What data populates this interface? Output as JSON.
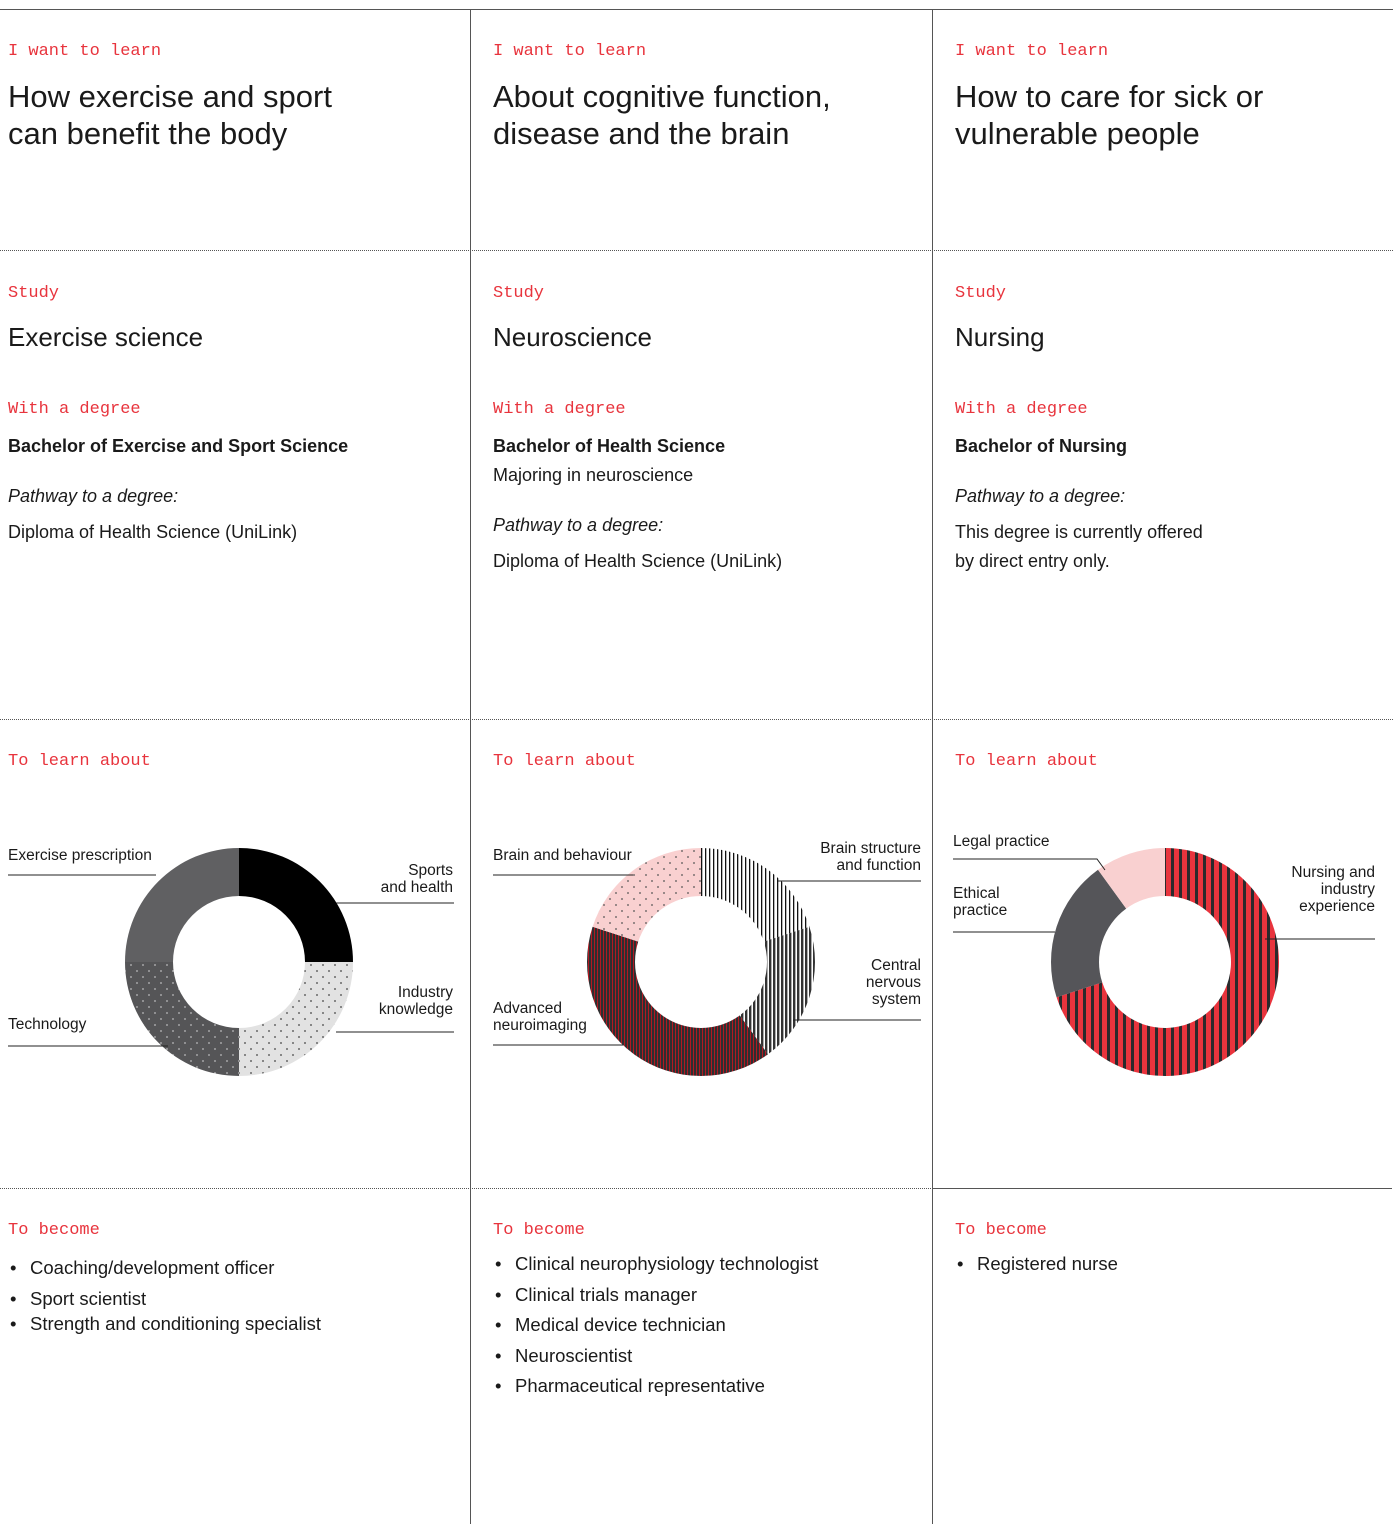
{
  "columns": [
    {
      "kicker": "I want to learn",
      "heading": [
        "How exercise and sport",
        "can benefit the body"
      ],
      "study_label": "Study",
      "study": "Exercise science",
      "degree_label": "With a degree",
      "degree": "Bachelor of Exercise and Sport Science",
      "major": "",
      "pathway_label": "Pathway to a degree:",
      "pathway": [
        "Diploma of Health Science (UniLink)"
      ],
      "learn_label": "To learn about",
      "become_label": "To become",
      "careers": [
        "Coaching/development officer",
        "Sport scientist",
        "Strength and conditioning specialist"
      ]
    },
    {
      "kicker": "I want to learn",
      "heading": [
        "About cognitive function,",
        "disease and the brain"
      ],
      "study_label": "Study",
      "study": "Neuroscience",
      "degree_label": "With a degree",
      "degree": "Bachelor of Health Science",
      "major": "Majoring in neuroscience",
      "pathway_label": "Pathway to a degree:",
      "pathway": [
        "Diploma of Health Science (UniLink)"
      ],
      "learn_label": "To learn about",
      "become_label": "To become",
      "careers": [
        "Clinical neurophysiology technologist",
        "Clinical trials manager",
        "Medical device technician",
        "Neuroscientist",
        "Pharmaceutical representative"
      ]
    },
    {
      "kicker": "I want to learn",
      "heading": [
        "How to care for sick or",
        "vulnerable people"
      ],
      "study_label": "Study",
      "study": "Nursing",
      "degree_label": "With a degree",
      "degree": "Bachelor of Nursing",
      "major": "",
      "pathway_label": "Pathway to a degree:",
      "pathway": [
        "This degree is currently offered",
        "by direct entry only."
      ],
      "learn_label": "To learn about",
      "become_label": "To become",
      "careers": [
        "Registered nurse"
      ]
    }
  ],
  "chart_data": [
    {
      "type": "pie",
      "donut": true,
      "legend": "callouts",
      "slices": [
        {
          "label": "Sports and health",
          "value": 25,
          "fill": "solid-black",
          "color": "#000000"
        },
        {
          "label": "Industry knowledge",
          "value": 25,
          "fill": "dotted-light-grey",
          "color": "#e2e2e2"
        },
        {
          "label": "Technology",
          "value": 25,
          "fill": "dotted-dark-grey",
          "color": "#555557"
        },
        {
          "label": "Exercise prescription",
          "value": 25,
          "fill": "solid-grey",
          "color": "#606062"
        }
      ]
    },
    {
      "type": "pie",
      "donut": true,
      "legend": "callouts",
      "slices": [
        {
          "label": "Brain structure and function",
          "value": 20,
          "fill": "vertical-stripes-white",
          "color": "#ffffff"
        },
        {
          "label": "Central nervous system",
          "value": 20,
          "fill": "vertical-stripes-grey",
          "color": "#4a4a4c"
        },
        {
          "label": "Advanced neuroimaging",
          "value": 40,
          "fill": "vertical-stripes-dark-red",
          "color": "#3a2a2c"
        },
        {
          "label": "Brain and behaviour",
          "value": 20,
          "fill": "dotted-pink",
          "color": "#f9d0d0"
        }
      ]
    },
    {
      "type": "pie",
      "donut": true,
      "legend": "callouts",
      "slices": [
        {
          "label": "Nursing and industry experience",
          "value": 70,
          "fill": "vertical-stripes-red",
          "color": "#e8343d"
        },
        {
          "label": "Ethical practice",
          "value": 20,
          "fill": "solid-dark-grey",
          "color": "#555559"
        },
        {
          "label": "Legal practice",
          "value": 10,
          "fill": "solid-pink",
          "color": "#f9d0d0"
        }
      ]
    }
  ]
}
